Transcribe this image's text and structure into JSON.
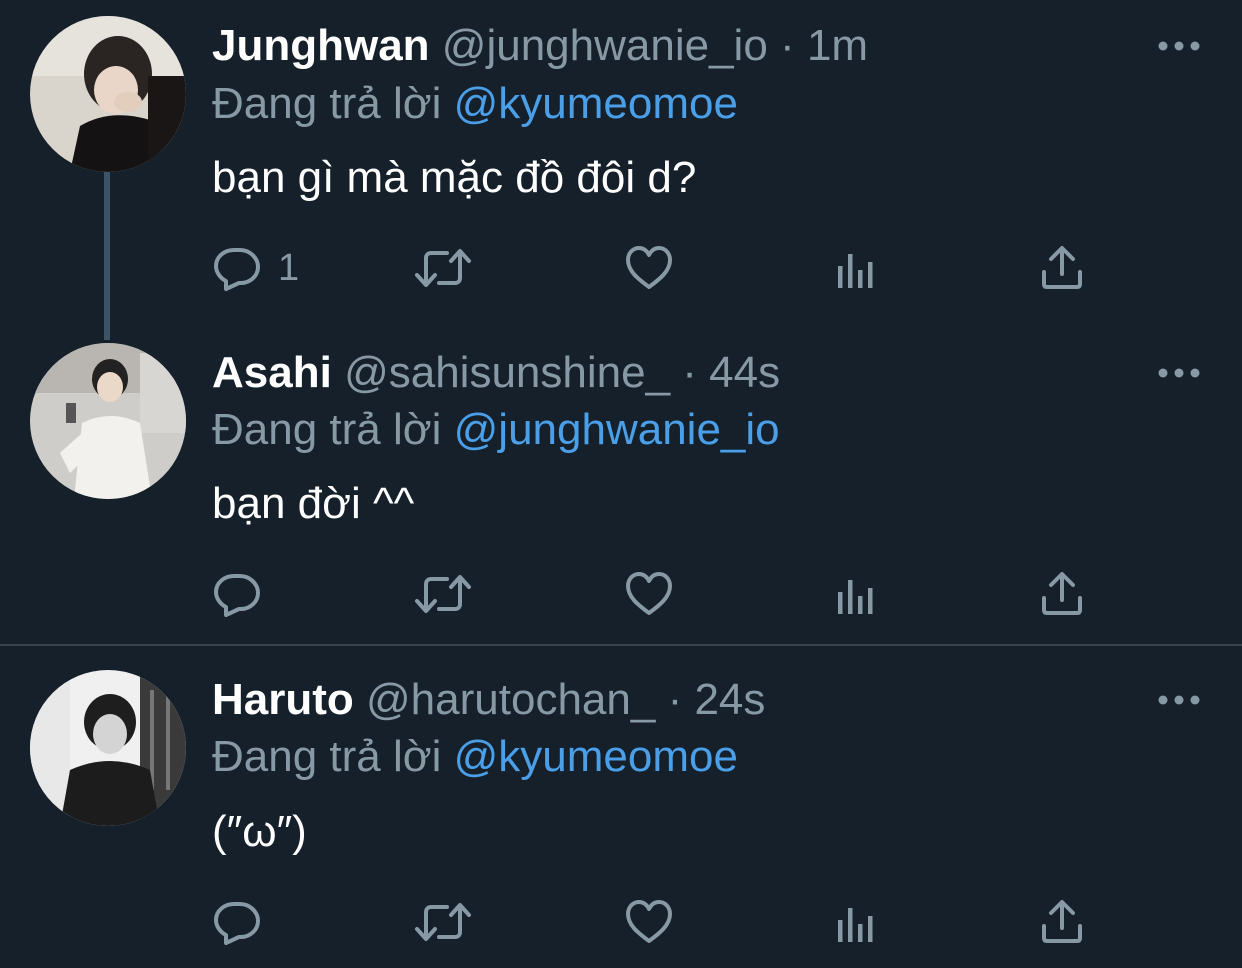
{
  "tweets": [
    {
      "name": "Junghwan",
      "handle": "@junghwanie_io",
      "separator": "·",
      "time": "1m",
      "replying_prefix": "Đang trả lời",
      "replying_to": "@kyumeomoe",
      "text": "bạn gì mà mặc đồ đôi d?",
      "reply_count": "1"
    },
    {
      "name": "Asahi",
      "handle": "@sahisunshine_",
      "separator": "·",
      "time": "44s",
      "replying_prefix": "Đang trả lời",
      "replying_to": "@junghwanie_io",
      "text": "bạn đời ^^",
      "reply_count": ""
    },
    {
      "name": "Haruto",
      "handle": "@harutochan_",
      "separator": "·",
      "time": "24s",
      "replying_prefix": "Đang trả lời",
      "replying_to": "@kyumeomoe",
      "text": "(″ω″)",
      "reply_count": ""
    }
  ],
  "icons": {
    "reply": "reply-icon",
    "retweet": "retweet-icon",
    "like": "heart-icon",
    "analytics": "analytics-icon",
    "share": "share-icon",
    "more": "more-icon"
  },
  "colors": {
    "background": "#15202b",
    "secondary_text": "#8899a6",
    "mention": "#4a9fe8",
    "thread_line": "#3d5466"
  }
}
